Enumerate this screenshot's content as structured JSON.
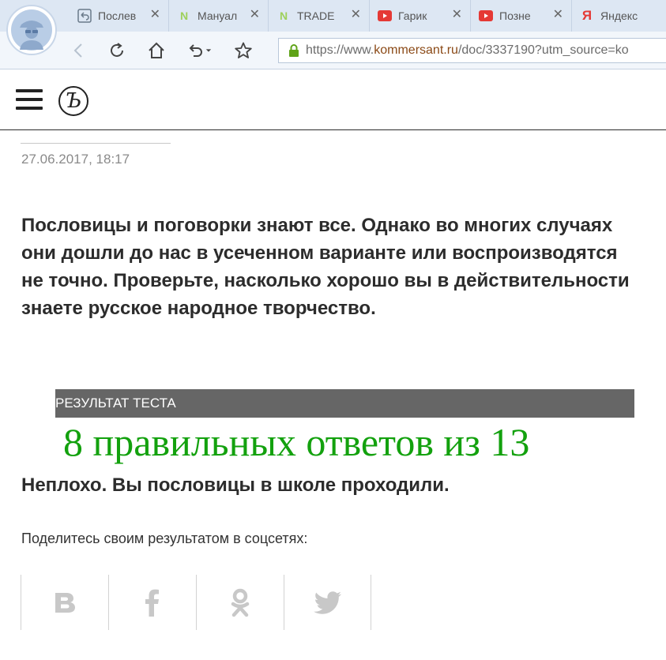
{
  "browser": {
    "tabs": [
      {
        "title": "Послев",
        "icon": "back-arrow-icon",
        "color": "#6a7a8a"
      },
      {
        "title": "Мануал",
        "icon": "n-icon",
        "color": "#9ed05b"
      },
      {
        "title": "TRADE",
        "icon": "n-icon",
        "color": "#9ed05b"
      },
      {
        "title": "Гарик",
        "icon": "youtube-icon",
        "color": "#e53935"
      },
      {
        "title": "Позне",
        "icon": "youtube-icon",
        "color": "#e53935"
      },
      {
        "title": "Яндекс",
        "icon": "yandex-icon",
        "color": "#e53935"
      }
    ],
    "close_glyph": "✕",
    "url_prefix": "https://www.",
    "url_domain": "kommersant.ru",
    "url_path": "/doc/3337190?utm_source=ko"
  },
  "site": {
    "logo_glyph": "Ъ"
  },
  "article": {
    "date": "27.06.2017, 18:17",
    "lead": "Пословицы и поговорки знают все. Однако во многих случаях они дошли до нас в усеченном варианте или воспроизводятся не точно. Проверьте, насколько хорошо вы в действительности знаете русское народное творчество.",
    "result_label": "РЕЗУЛЬТАТ ТЕСТА",
    "result_score": "8 правильных ответов из 13",
    "verdict": "Неплохо. Вы пословицы в школе проходили.",
    "share_prompt": "Поделитесь своим результатом в соцсетях:"
  },
  "share": [
    {
      "name": "vk",
      "icon": "vk-icon"
    },
    {
      "name": "facebook",
      "icon": "facebook-icon"
    },
    {
      "name": "odnoklassniki",
      "icon": "odnoklassniki-icon"
    },
    {
      "name": "twitter",
      "icon": "twitter-icon"
    }
  ],
  "colors": {
    "score_green": "#13a10e",
    "result_bar": "#666666",
    "share_icon": "#c8c8c8"
  }
}
